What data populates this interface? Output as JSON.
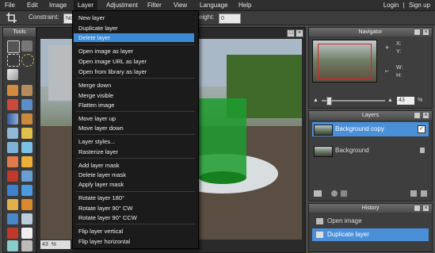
{
  "menubar": {
    "items": [
      "File",
      "Edit",
      "Image",
      "Layer",
      "Adjustment",
      "Filter",
      "View",
      "Language",
      "Help"
    ],
    "active": "Layer",
    "login": "Login",
    "divider": "|",
    "signup": "Sign up"
  },
  "options": {
    "constraint_label": "Constraint:",
    "constraint_value": "No",
    "height_label": "eight:",
    "height_value": "0"
  },
  "tools": {
    "title": "Tools"
  },
  "canvas": {
    "zoom_value": "43",
    "zoom_unit": "%"
  },
  "layer_menu": [
    "New layer",
    "Duplicate layer",
    "Delete layer",
    "Open image as layer",
    "Open image URL as layer",
    "Open from library as layer",
    "Merge down",
    "Merge visible",
    "Flatten image",
    "Move layer up",
    "Move layer down",
    "Layer styles...",
    "Rasterize layer",
    "Add layer mask",
    "Delete layer mask",
    "Apply layer mask",
    "Rotate layer 180°",
    "Rotate layer 90° CW",
    "Rotate layer 90° CCW",
    "Flip layer vertical",
    "Flip layer horizontal"
  ],
  "layer_menu_highlight": "Delete layer",
  "navigator": {
    "title": "Navigator",
    "x_label": "X:",
    "y_label": "Y:",
    "w_label": "W:",
    "h_label": "H:",
    "zoom_value": "43",
    "zoom_unit": "%"
  },
  "layers": {
    "title": "Layers",
    "items": [
      {
        "name": "Background copy",
        "selected": true
      },
      {
        "name": "Background",
        "selected": false
      }
    ]
  },
  "history": {
    "title": "History",
    "items": [
      {
        "name": "Open image",
        "selected": false
      },
      {
        "name": "Duplicate layer",
        "selected": true
      }
    ]
  },
  "colors": {
    "accent": "#3b8ad6",
    "selection": "#4a90d9"
  }
}
